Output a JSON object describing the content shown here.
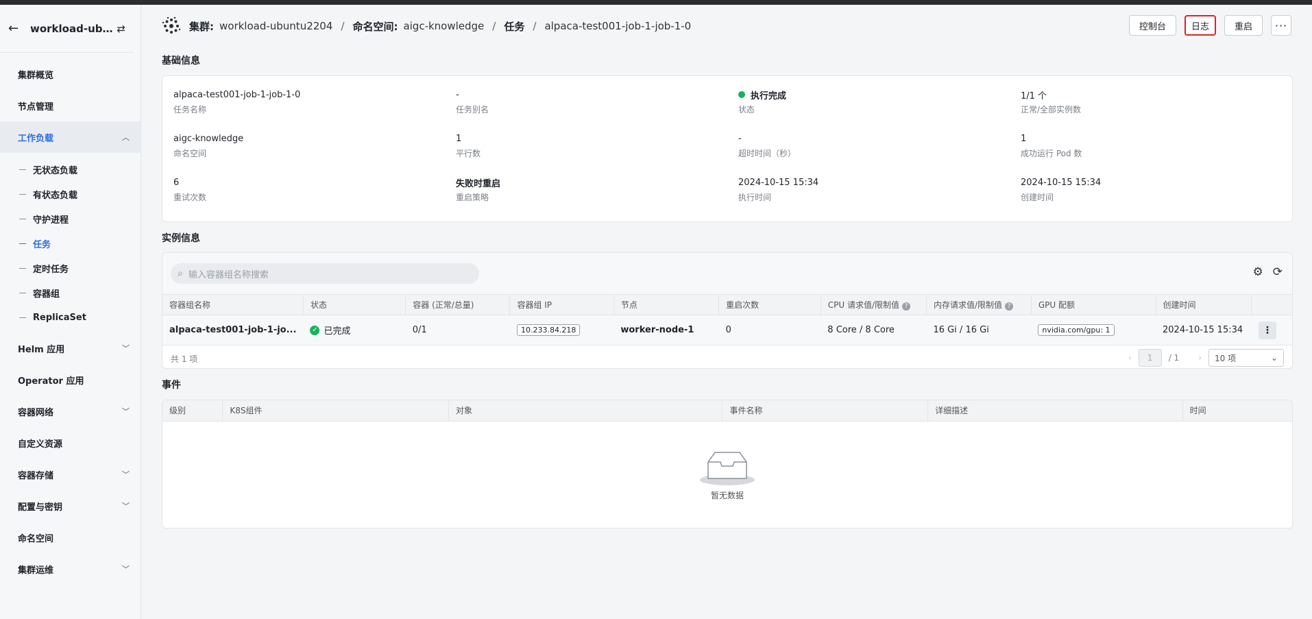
{
  "sidebar": {
    "cluster_name": "workload-ubuntu2204",
    "items": [
      {
        "label": "集群概览"
      },
      {
        "label": "节点管理"
      },
      {
        "label": "工作负载"
      },
      {
        "label": "Helm 应用"
      },
      {
        "label": "Operator 应用"
      },
      {
        "label": "容器网络"
      },
      {
        "label": "自定义资源"
      },
      {
        "label": "容器存储"
      },
      {
        "label": "配置与密钥"
      },
      {
        "label": "命名空间"
      },
      {
        "label": "集群运维"
      }
    ],
    "workload_sub": [
      {
        "label": "无状态负载"
      },
      {
        "label": "有状态负载"
      },
      {
        "label": "守护进程"
      },
      {
        "label": "任务"
      },
      {
        "label": "定时任务"
      },
      {
        "label": "容器组"
      },
      {
        "label": "ReplicaSet"
      }
    ]
  },
  "breadcrumb": {
    "cluster_label": "集群:",
    "cluster_value": "workload-ubuntu2204",
    "ns_label": "命名空间:",
    "ns_value": "aigc-knowledge",
    "section": "任务",
    "current": "alpaca-test001-job-1-job-1-0",
    "sep": "/"
  },
  "actions": {
    "console": "控制台",
    "logs": "日志",
    "restart": "重启",
    "more": "···"
  },
  "basic_info": {
    "title": "基础信息",
    "fields": [
      {
        "value": "alpaca-test001-job-1-job-1-0",
        "key": "任务名称"
      },
      {
        "value": "-",
        "key": "任务别名"
      },
      {
        "value": "执行完成",
        "key": "状态"
      },
      {
        "value": "1/1 个",
        "key": "正常/全部实例数"
      },
      {
        "value": "aigc-knowledge",
        "key": "命名空间"
      },
      {
        "value": "1",
        "key": "平行数"
      },
      {
        "value": "-",
        "key": "超时时间（秒）"
      },
      {
        "value": "1",
        "key": "成功运行 Pod 数"
      },
      {
        "value": "6",
        "key": "重试次数"
      },
      {
        "value": "失败时重启",
        "key": "重启策略"
      },
      {
        "value": "2024-10-15 15:34",
        "key": "执行时间"
      },
      {
        "value": "2024-10-15 15:34",
        "key": "创建时间"
      }
    ]
  },
  "instances": {
    "title": "实例信息",
    "search_placeholder": "输入容器组名称搜索",
    "columns": [
      "容器组名称",
      "状态",
      "容器 (正常/总量)",
      "容器组 IP",
      "节点",
      "重启次数",
      "CPU 请求值/限制值",
      "内存请求值/限制值",
      "GPU 配额",
      "创建时间"
    ],
    "row": {
      "name": "alpaca-test001-job-1-jo...",
      "status": "已完成",
      "containers": "0/1",
      "ip": "10.233.84.218",
      "node": "worker-node-1",
      "restarts": "0",
      "cpu": "8 Core / 8 Core",
      "mem": "16 Gi / 16 Gi",
      "gpu": "nvidia.com/gpu: 1",
      "created": "2024-10-15 15:34"
    },
    "total": "共 1 项",
    "page_current": "1",
    "page_total": "/ 1",
    "page_size": "10 项"
  },
  "events": {
    "title": "事件",
    "columns": [
      "级别",
      "K8S组件",
      "对象",
      "事件名称",
      "详细描述",
      "时间"
    ],
    "empty_text": "暂无数据"
  }
}
